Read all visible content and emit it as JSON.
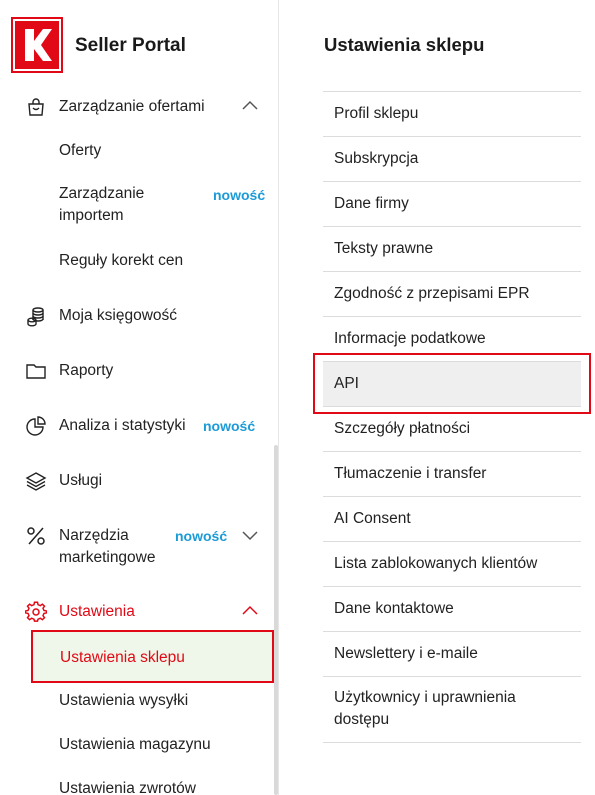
{
  "brand": {
    "name": "Seller Portal"
  },
  "colors": {
    "accent": "#e10915",
    "badge": "#1b9bd7",
    "selected_bg": "#eef7e9"
  },
  "sidebar": {
    "items": [
      {
        "label": "Zarządzanie ofertami",
        "icon": "shopping-bag-icon",
        "chevron": "up"
      },
      {
        "label": "Oferty"
      },
      {
        "label": "Zarządzanie importem",
        "badge": "nowość"
      },
      {
        "label": "Reguły korekt cen"
      },
      {
        "label": "Moja księgowość",
        "icon": "coins-icon"
      },
      {
        "label": "Raporty",
        "icon": "folder-icon"
      },
      {
        "label": "Analiza i statystyki",
        "icon": "pie-chart-icon",
        "badge": "nowość"
      },
      {
        "label": "Usługi",
        "icon": "layers-icon"
      },
      {
        "label": "Narzędzia marketingowe",
        "icon": "percent-icon",
        "badge": "nowość",
        "chevron": "down"
      },
      {
        "label": "Ustawienia",
        "icon": "gear-icon",
        "chevron": "up"
      },
      {
        "label": "Ustawienia sklepu"
      },
      {
        "label": "Ustawienia wysyłki"
      },
      {
        "label": "Ustawienia magazynu"
      },
      {
        "label": "Ustawienia zwrotów"
      }
    ],
    "import_label_line1": "Zarządzanie",
    "import_label_line2": "importem",
    "marketing_label_line1": "Narzędzia",
    "marketing_label_line2": "marketingowe"
  },
  "main": {
    "title": "Ustawienia sklepu",
    "menu": [
      "Profil sklepu",
      "Subskrypcja",
      "Dane firmy",
      "Teksty prawne",
      "Zgodność z przepisami EPR",
      "Informacje podatkowe",
      "API",
      "Szczegóły płatności",
      "Tłumaczenie i transfer",
      "AI Consent",
      "Lista zablokowanych klientów",
      "Dane kontaktowe",
      "Newslettery i e-maile",
      "Użytkownicy i uprawnienia dostępu"
    ],
    "selected": "API"
  }
}
